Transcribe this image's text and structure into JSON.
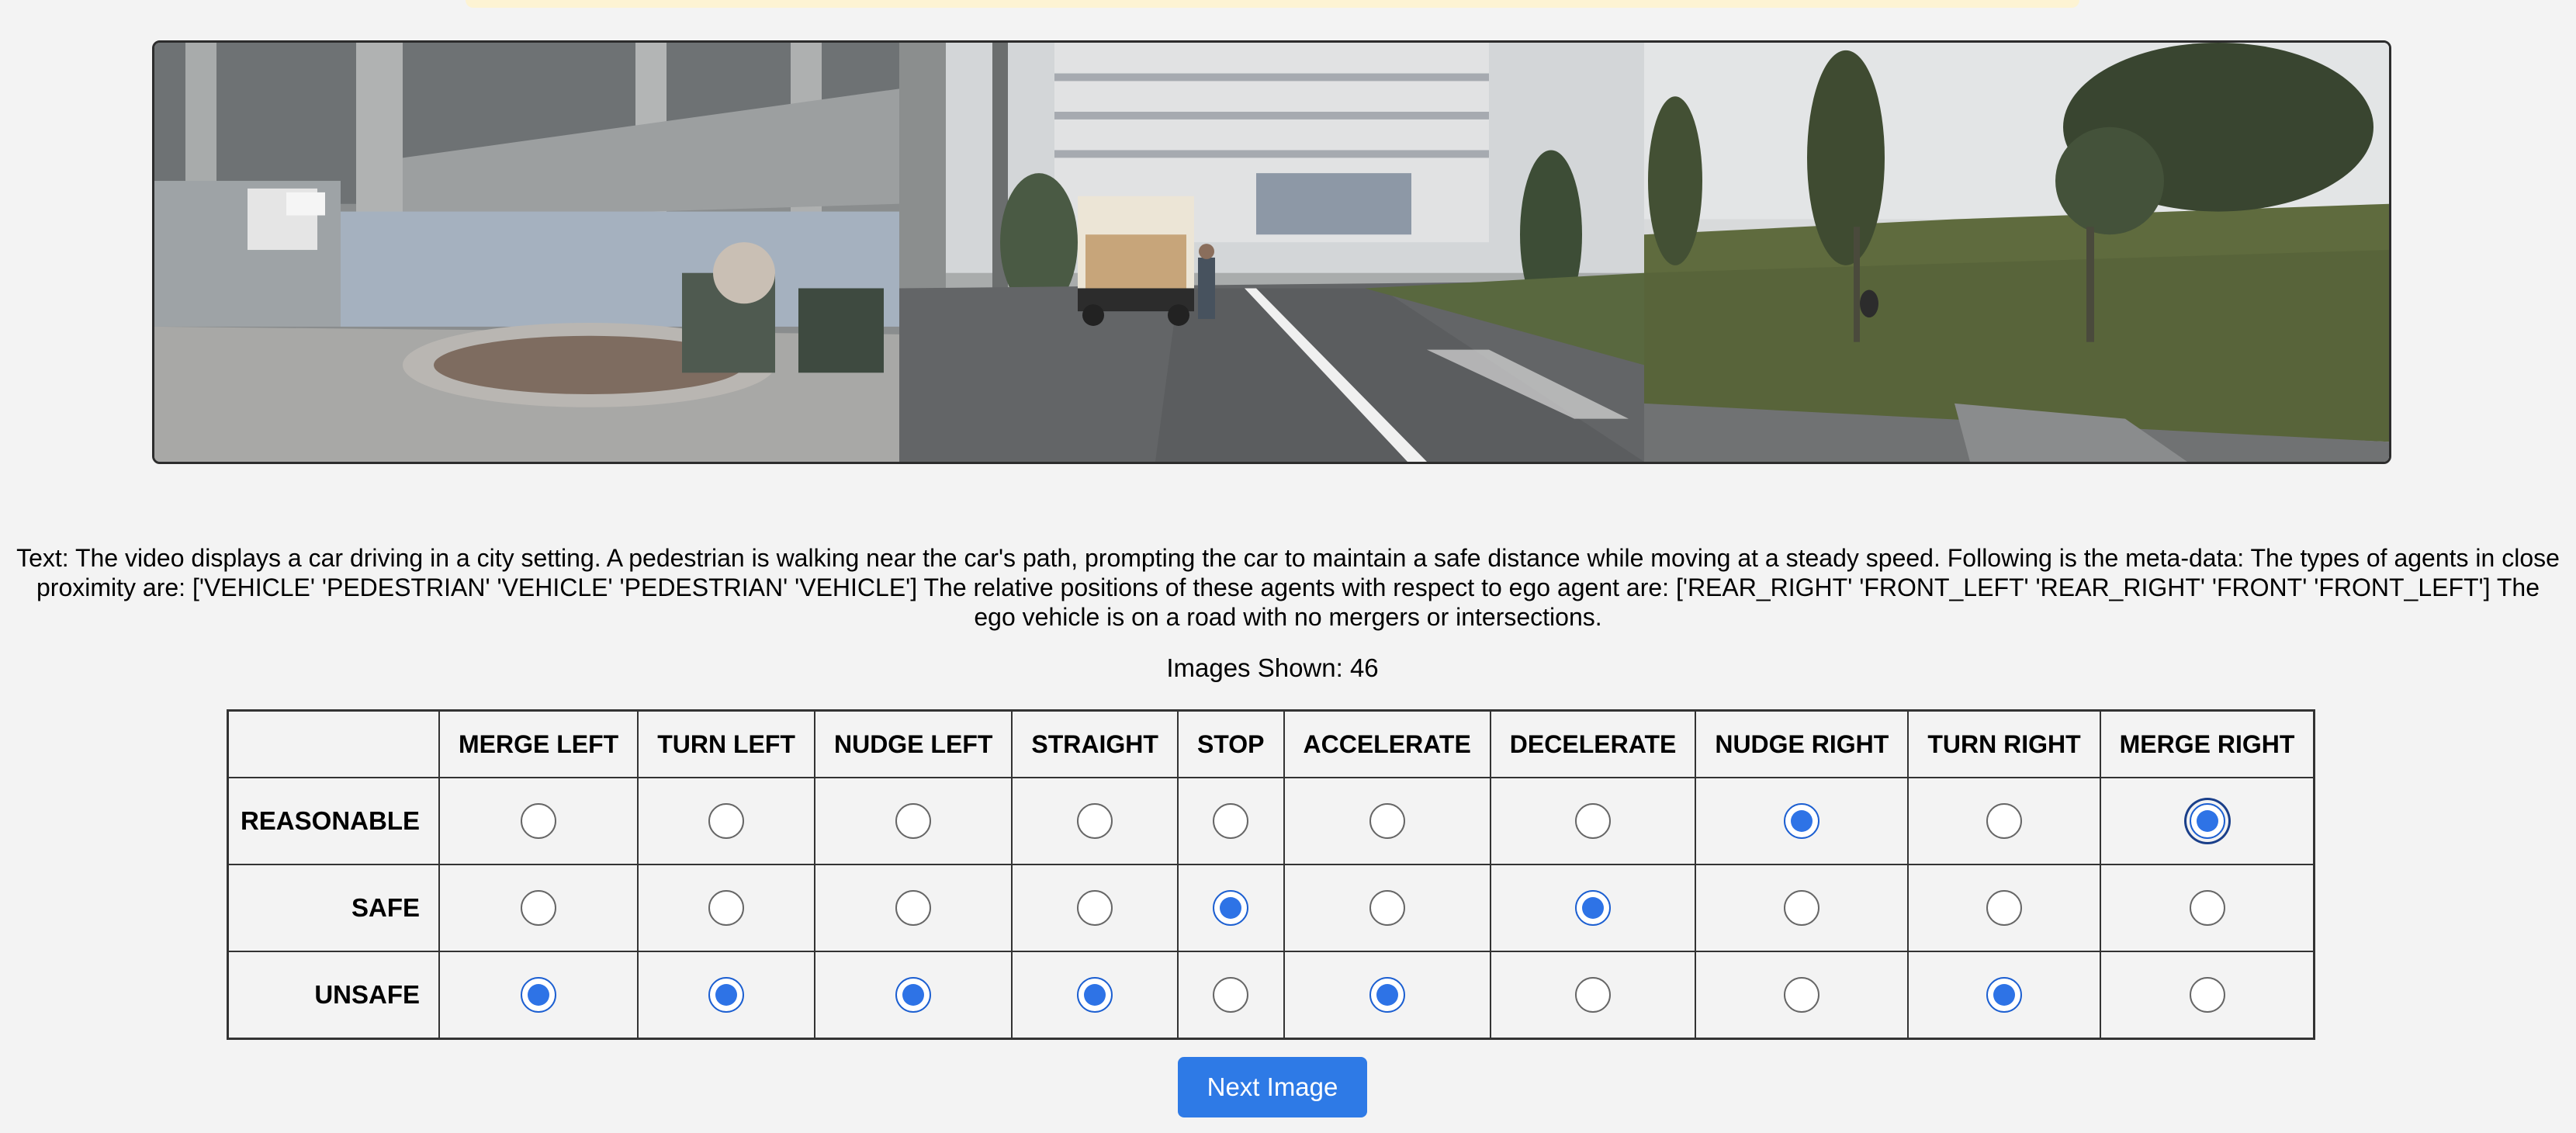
{
  "description": "Text: The video displays a car driving in a city setting. A pedestrian is walking near the car's path, prompting the car to maintain a safe distance while moving at a steady speed. Following is the meta-data: The types of agents in close proximity are: ['VEHICLE' 'PEDESTRIAN' 'VEHICLE' 'PEDESTRIAN' 'VEHICLE'] The relative positions of these agents with respect to ego agent are: ['REAR_RIGHT' 'FRONT_LEFT' 'REAR_RIGHT' 'FRONT' 'FRONT_LEFT'] The ego vehicle is on a road with no mergers or intersections.",
  "images_shown": "Images Shown: 46",
  "actions": [
    "MERGE LEFT",
    "TURN LEFT",
    "NUDGE LEFT",
    "STRAIGHT",
    "STOP",
    "ACCELERATE",
    "DECELERATE",
    "NUDGE RIGHT",
    "TURN RIGHT",
    "MERGE RIGHT"
  ],
  "rows": [
    {
      "label": "REASONABLE",
      "selected": [
        false,
        false,
        false,
        false,
        false,
        false,
        false,
        true,
        false,
        true
      ]
    },
    {
      "label": "SAFE",
      "selected": [
        false,
        false,
        false,
        false,
        true,
        false,
        true,
        false,
        false,
        false
      ]
    },
    {
      "label": "UNSAFE",
      "selected": [
        true,
        true,
        true,
        true,
        false,
        true,
        false,
        false,
        true,
        false
      ]
    }
  ],
  "next_button": "Next Image",
  "camera_views": [
    "front-left-camera",
    "front-camera",
    "front-right-camera"
  ]
}
